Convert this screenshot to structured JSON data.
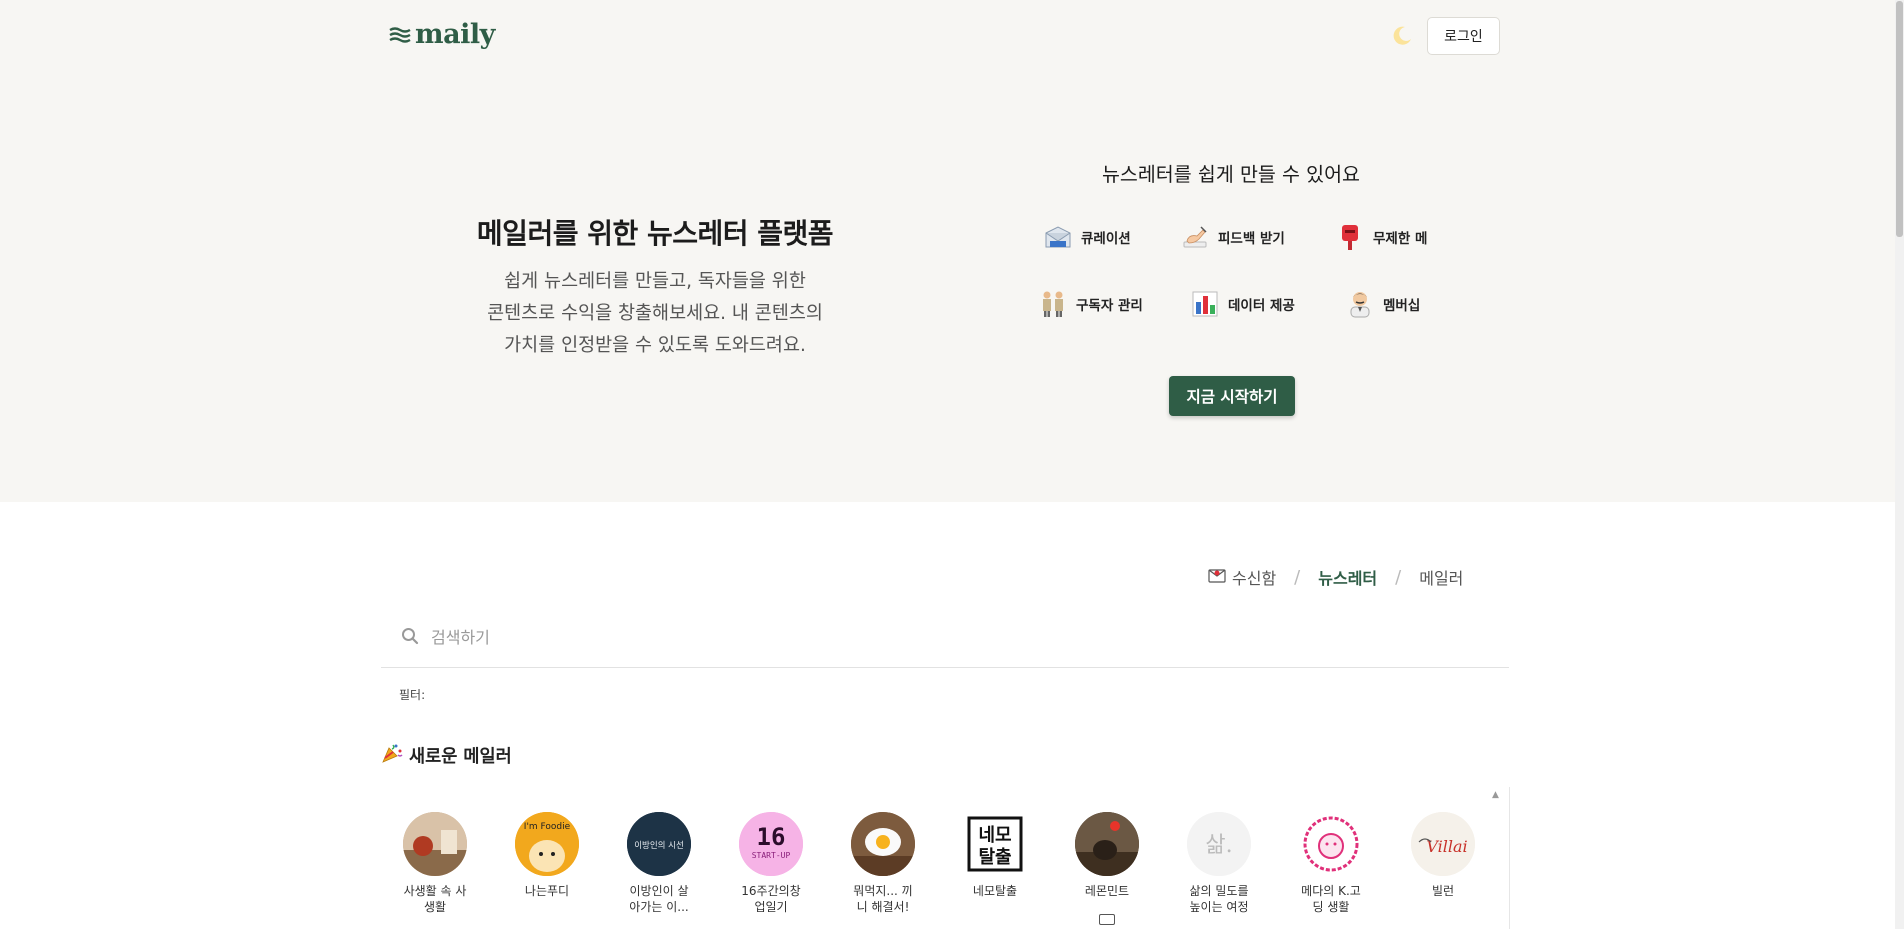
{
  "header": {
    "logo_text": "maily",
    "login_label": "로그인"
  },
  "hero": {
    "title": "메일러를 위한 뉴스레터 플랫폼",
    "desc_line1": "쉽게 뉴스레터를 만들고, 독자들을 위한",
    "desc_line2": "콘텐츠로 수익을 창출해보세요. 내 콘텐츠의",
    "desc_line3": "가치를 인정받을 수 있도록 도와드려요.",
    "features_title": "뉴스레터를 쉽게 만들 수 있어요",
    "features": [
      {
        "label": "큐레이션",
        "icon": "envelope-icon"
      },
      {
        "label": "피드백 받기",
        "icon": "writing-hand-icon"
      },
      {
        "label": "무제한 메",
        "icon": "postbox-icon"
      },
      {
        "label": "구독자 관리",
        "icon": "people-icon"
      },
      {
        "label": "데이터 제공",
        "icon": "bar-chart-icon"
      },
      {
        "label": "멤버십",
        "icon": "person-icon"
      }
    ],
    "start_label": "지금 시작하기"
  },
  "tabs": {
    "inbox": "수신함",
    "newsletter": "뉴스레터",
    "mailer": "메일러",
    "active": "뉴스레터"
  },
  "search": {
    "placeholder": "검색하기"
  },
  "filter_label": "필터:",
  "new_mailers": {
    "title": "새로운 메일러",
    "items": [
      {
        "name": "사생활 속 사\n생활"
      },
      {
        "name": "나는푸디"
      },
      {
        "name": "이방인이 살\n아가는 이..."
      },
      {
        "name": "16주간의창\n업일기"
      },
      {
        "name": "뭐먹지... 끼\n니 해결서!"
      },
      {
        "name": "네모탈출"
      },
      {
        "name": "레몬민트"
      },
      {
        "name": "삶의 밀도를\n높이는 여정"
      },
      {
        "name": "메다의 K.고\n딩 생활"
      },
      {
        "name": "빌런"
      }
    ],
    "avatar_texts": {
      "foodie": "I'm Foodie",
      "stranger": "이방인의 시선",
      "sixteen_num": "16",
      "sixteen_sub": "START-UP",
      "nemo_line1": "네모",
      "nemo_line2": "탈출",
      "life_char": "삶.",
      "villain": "Villai"
    }
  },
  "colors": {
    "brand_green": "#2f5d46",
    "hero_bg": "#f7f6f3"
  }
}
